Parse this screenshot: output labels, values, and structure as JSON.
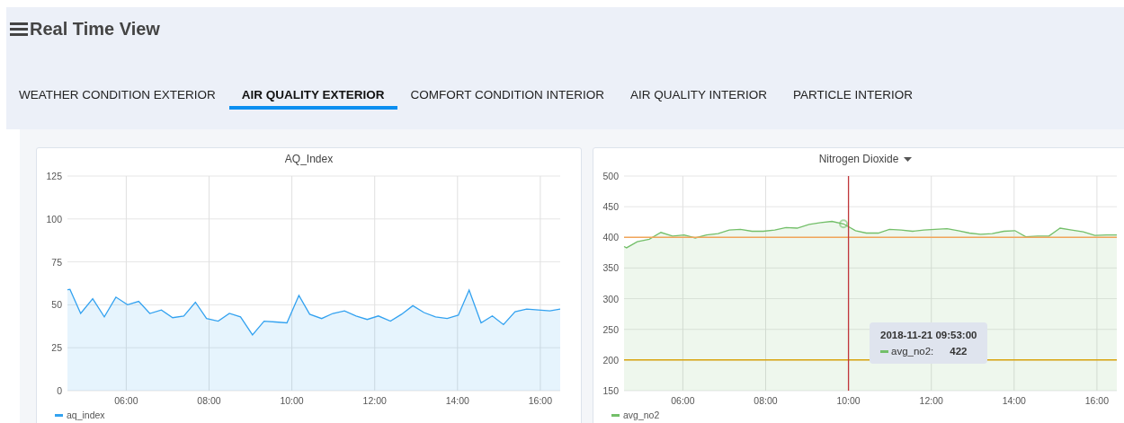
{
  "header": {
    "title": "Real Time View"
  },
  "tabs": [
    {
      "label": "WEATHER CONDITION EXTERIOR",
      "selected": false
    },
    {
      "label": "AIR QUALITY EXTERIOR",
      "selected": true
    },
    {
      "label": "COMFORT CONDITION INTERIOR",
      "selected": false
    },
    {
      "label": "AIR QUALITY INTERIOR",
      "selected": false
    },
    {
      "label": "PARTICLE INTERIOR",
      "selected": false
    }
  ],
  "panels": [
    {
      "title": "AQ_Index",
      "has_menu": false,
      "chart_data": {
        "type": "area",
        "grid": true,
        "x": [
          4.58,
          4.64,
          4.9,
          5.19,
          5.47,
          5.75,
          6.03,
          6.3,
          6.57,
          6.85,
          7.12,
          7.39,
          7.67,
          7.94,
          8.22,
          8.49,
          8.76,
          9.05,
          9.33,
          9.6,
          9.88,
          10.17,
          10.43,
          10.72,
          10.99,
          11.27,
          11.55,
          11.82,
          12.09,
          12.38,
          12.65,
          12.92,
          13.19,
          13.47,
          13.75,
          14.02,
          14.28,
          14.57,
          14.84,
          15.11,
          15.39,
          15.67,
          15.95,
          16.23,
          16.48
        ],
        "series": [
          {
            "name": "aq_index",
            "color": "#33a2f0",
            "values": [
              58.8,
              59,
              45,
              53.5,
              43,
              54.5,
              50,
              52,
              45,
              47,
              42.5,
              43.5,
              51.5,
              42,
              40.5,
              45,
              43,
              32.5,
              40.5,
              40,
              39.5,
              55.5,
              44.5,
              42,
              45,
              46.5,
              43.5,
              41.5,
              43.5,
              40.5,
              44.5,
              49.5,
              45.5,
              43,
              42,
              44,
              58.5,
              39.5,
              43.5,
              38.5,
              46,
              47.5,
              47,
              46.5,
              47.5
            ]
          }
        ],
        "xlim": [
          4.58,
          16.48
        ],
        "ylim": [
          0,
          125
        ],
        "xticks": [
          {
            "value": 6,
            "label": "06:00"
          },
          {
            "value": 8,
            "label": "08:00"
          },
          {
            "value": 10,
            "label": "10:00"
          },
          {
            "value": 12,
            "label": "12:00"
          },
          {
            "value": 14,
            "label": "14:00"
          },
          {
            "value": 16,
            "label": "16:00"
          }
        ],
        "yticks": [
          0,
          25,
          50,
          75,
          100,
          125
        ]
      }
    },
    {
      "title": "Nitrogen Dioxide",
      "has_menu": true,
      "chart_data": {
        "type": "area",
        "grid": true,
        "x": [
          4.58,
          4.64,
          4.9,
          5.19,
          5.47,
          5.75,
          6.03,
          6.3,
          6.57,
          6.85,
          7.12,
          7.39,
          7.67,
          7.94,
          8.22,
          8.49,
          8.76,
          9.05,
          9.33,
          9.6,
          9.88,
          10.17,
          10.43,
          10.72,
          10.99,
          11.27,
          11.55,
          11.82,
          12.09,
          12.38,
          12.65,
          12.92,
          13.19,
          13.47,
          13.75,
          14.02,
          14.28,
          14.57,
          14.84,
          15.11,
          15.39,
          15.67,
          15.95,
          16.23,
          16.48
        ],
        "series": [
          {
            "name": "avg_no2",
            "color": "#73bf69",
            "values": [
              385,
              383,
              393,
              397,
              408,
              402,
              404,
              399,
              404,
              406,
              412,
              413,
              410,
              410,
              412,
              416,
              415,
              421,
              424,
              426,
              422,
              411,
              407,
              407,
              413,
              412,
              410,
              412,
              413,
              414,
              411,
              407,
              405,
              406,
              410,
              411,
              401,
              402,
              402,
              415,
              412,
              409,
              403,
              404,
              404
            ]
          }
        ],
        "xlim": [
          4.58,
          16.48
        ],
        "ylim": [
          150,
          500
        ],
        "xticks": [
          {
            "value": 6,
            "label": "06:00"
          },
          {
            "value": 8,
            "label": "08:00"
          },
          {
            "value": 10,
            "label": "10:00"
          },
          {
            "value": 12,
            "label": "12:00"
          },
          {
            "value": 14,
            "label": "14:00"
          },
          {
            "value": 16,
            "label": "16:00"
          }
        ],
        "yticks": [
          150,
          200,
          250,
          300,
          350,
          400,
          450,
          500
        ],
        "ref_lines": [
          {
            "axis": "y",
            "value": 400,
            "color": "#f2a55a"
          },
          {
            "axis": "y",
            "value": 200,
            "color": "#d9a40e"
          },
          {
            "axis": "x",
            "value": 10,
            "color": "#c0363b"
          }
        ]
      },
      "tooltip": {
        "time": "2018-11-21 09:53:00",
        "series": "avg_no2:",
        "value": "422"
      }
    }
  ]
}
